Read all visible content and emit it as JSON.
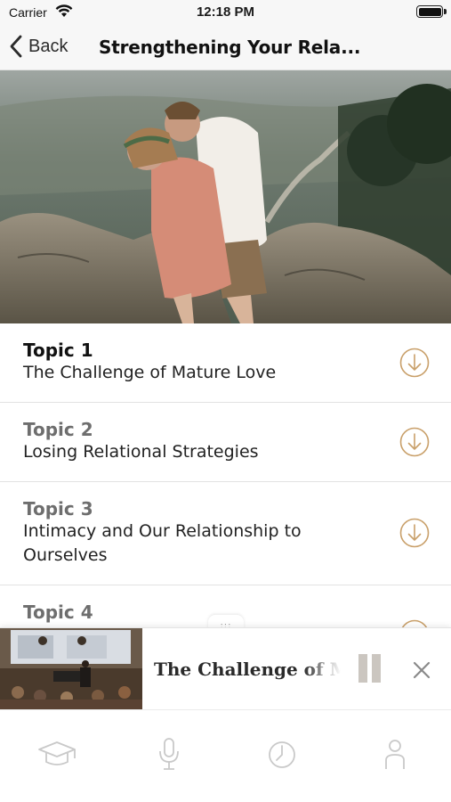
{
  "status_bar": {
    "carrier": "Carrier",
    "time": "12:18 PM"
  },
  "nav": {
    "back_label": "Back",
    "title": "Strengthening Your Rela..."
  },
  "topics": [
    {
      "number": "Topic 1",
      "title_lines": [
        "The Challenge of Mature Love"
      ],
      "active": true
    },
    {
      "number": "Topic 2",
      "title_lines": [
        "Losing Relational Strategies"
      ],
      "active": false
    },
    {
      "number": "Topic 3",
      "title_lines": [
        "Intimacy and Our Relationship to",
        "Ourselves"
      ],
      "active": false
    },
    {
      "number": "Topic 4",
      "title_lines": [],
      "active": false
    }
  ],
  "player": {
    "title": "The Challenge of Mature Love"
  },
  "tabs": [
    {
      "icon": "graduation-cap-icon"
    },
    {
      "icon": "microphone-icon"
    },
    {
      "icon": "clock-icon"
    },
    {
      "icon": "person-icon"
    }
  ],
  "colors": {
    "accent": "#c9a06a",
    "inactive_icon": "#c9c9c9",
    "pause": "#cbc6c0"
  }
}
